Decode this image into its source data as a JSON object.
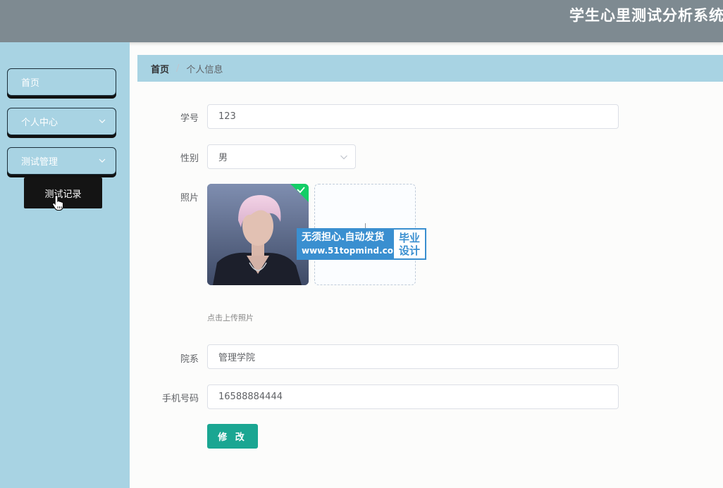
{
  "header": {
    "title": "学生心里测试分析系统"
  },
  "sidebar": {
    "items": [
      {
        "label": "首页"
      },
      {
        "label": "个人中心"
      },
      {
        "label": "测试管理"
      }
    ],
    "submenu_popup": {
      "label": "测试记录"
    }
  },
  "breadcrumb": {
    "home": "首页",
    "current": "个人信息"
  },
  "form": {
    "student_id": {
      "label": "学号",
      "value": "123"
    },
    "gender": {
      "label": "性别",
      "value": "男"
    },
    "photo": {
      "label": "照片",
      "tip": "点击上传照片"
    },
    "department": {
      "label": "院系",
      "value": "管理学院"
    },
    "phone": {
      "label": "手机号码",
      "value": "16588884444"
    },
    "submit_label": "修 改"
  },
  "watermark": {
    "line1": "无须担心.自动发货",
    "line2": "www.51topmind.com",
    "badge_line1": "毕业",
    "badge_line2": "设计"
  },
  "colors": {
    "header_bg": "#7e8a91",
    "sidebar_bg": "#a8d3e3",
    "accent": "#1aa692",
    "popup_bg": "#141414"
  }
}
